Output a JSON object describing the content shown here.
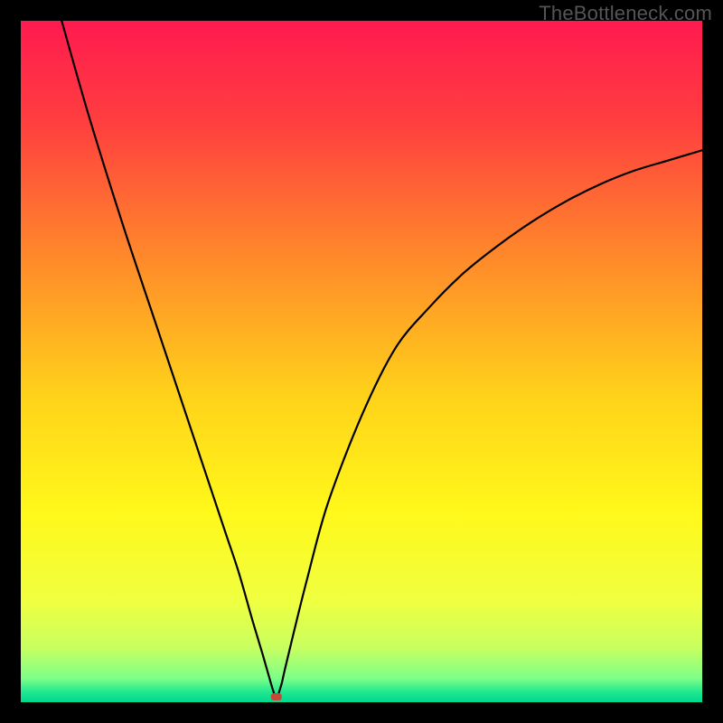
{
  "watermark": "TheBottleneck.com",
  "chart_data": {
    "type": "line",
    "title": "",
    "xlabel": "",
    "ylabel": "",
    "xlim": [
      0,
      100
    ],
    "ylim": [
      0,
      100
    ],
    "grid": false,
    "legend": false,
    "series": [
      {
        "name": "curve",
        "x": [
          6,
          10,
          15,
          20,
          25,
          28,
          30,
          32,
          34,
          35.5,
          36.5,
          37,
          37.3,
          37.5,
          37.8,
          38,
          38.3,
          38.8,
          40,
          42,
          45,
          50,
          55,
          60,
          65,
          70,
          75,
          80,
          85,
          90,
          95,
          100
        ],
        "y": [
          100,
          86,
          70,
          55,
          40,
          31,
          25,
          19,
          12,
          7,
          3.5,
          1.8,
          1.0,
          1.0,
          1.2,
          1.8,
          2.8,
          5,
          10,
          18,
          29,
          42,
          52,
          58,
          63,
          67,
          70.5,
          73.5,
          76,
          78,
          79.5,
          81
        ]
      }
    ],
    "marker": {
      "x": 37.5,
      "y": 0.8
    },
    "background": {
      "type": "vertical-gradient",
      "stops": [
        {
          "offset": 0.0,
          "color": "#ff1a4f"
        },
        {
          "offset": 0.15,
          "color": "#ff3f3f"
        },
        {
          "offset": 0.35,
          "color": "#ff8a2a"
        },
        {
          "offset": 0.55,
          "color": "#ffd21a"
        },
        {
          "offset": 0.72,
          "color": "#fff81a"
        },
        {
          "offset": 0.85,
          "color": "#f0ff40"
        },
        {
          "offset": 0.92,
          "color": "#c8ff60"
        },
        {
          "offset": 0.965,
          "color": "#7dff88"
        },
        {
          "offset": 0.985,
          "color": "#20e88f"
        },
        {
          "offset": 1.0,
          "color": "#00d890"
        }
      ]
    }
  }
}
